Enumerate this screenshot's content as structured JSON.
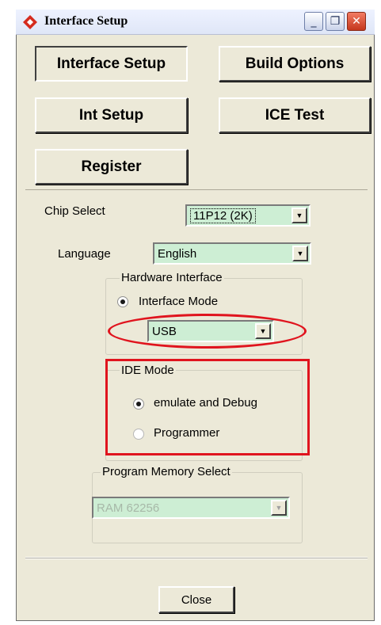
{
  "window": {
    "title": "Interface Setup",
    "minimize_glyph": "_",
    "restore_glyph": "❐",
    "close_glyph": "✕"
  },
  "nav": {
    "interface_setup": "Interface Setup",
    "build_options": "Build Options",
    "int_setup": "Int Setup",
    "ice_test": "ICE Test",
    "register": "Register"
  },
  "chip_select": {
    "label": "Chip Select",
    "value": "11P12 (2K)"
  },
  "language": {
    "label": "Language",
    "value": "English"
  },
  "hardware_interface": {
    "legend": "Hardware Interface",
    "radio_label": "Interface Mode",
    "radio_selected": true,
    "port_value": "USB"
  },
  "ide_mode": {
    "legend": "IDE Mode",
    "options": [
      {
        "label": "emulate and Debug",
        "selected": true
      },
      {
        "label": "Programmer",
        "selected": false
      }
    ]
  },
  "program_memory": {
    "legend": "Program Memory Select",
    "value": "RAM 62256",
    "enabled": false
  },
  "footer": {
    "close_label": "Close"
  },
  "colors": {
    "window_bg": "#ece9d8",
    "combo_bg": "#cdeed4",
    "annotation_red": "#e0141e",
    "close_red": "#c5371d"
  },
  "icons": {
    "app": "app-diamond-icon",
    "dropdown": "chevron-down-icon"
  }
}
